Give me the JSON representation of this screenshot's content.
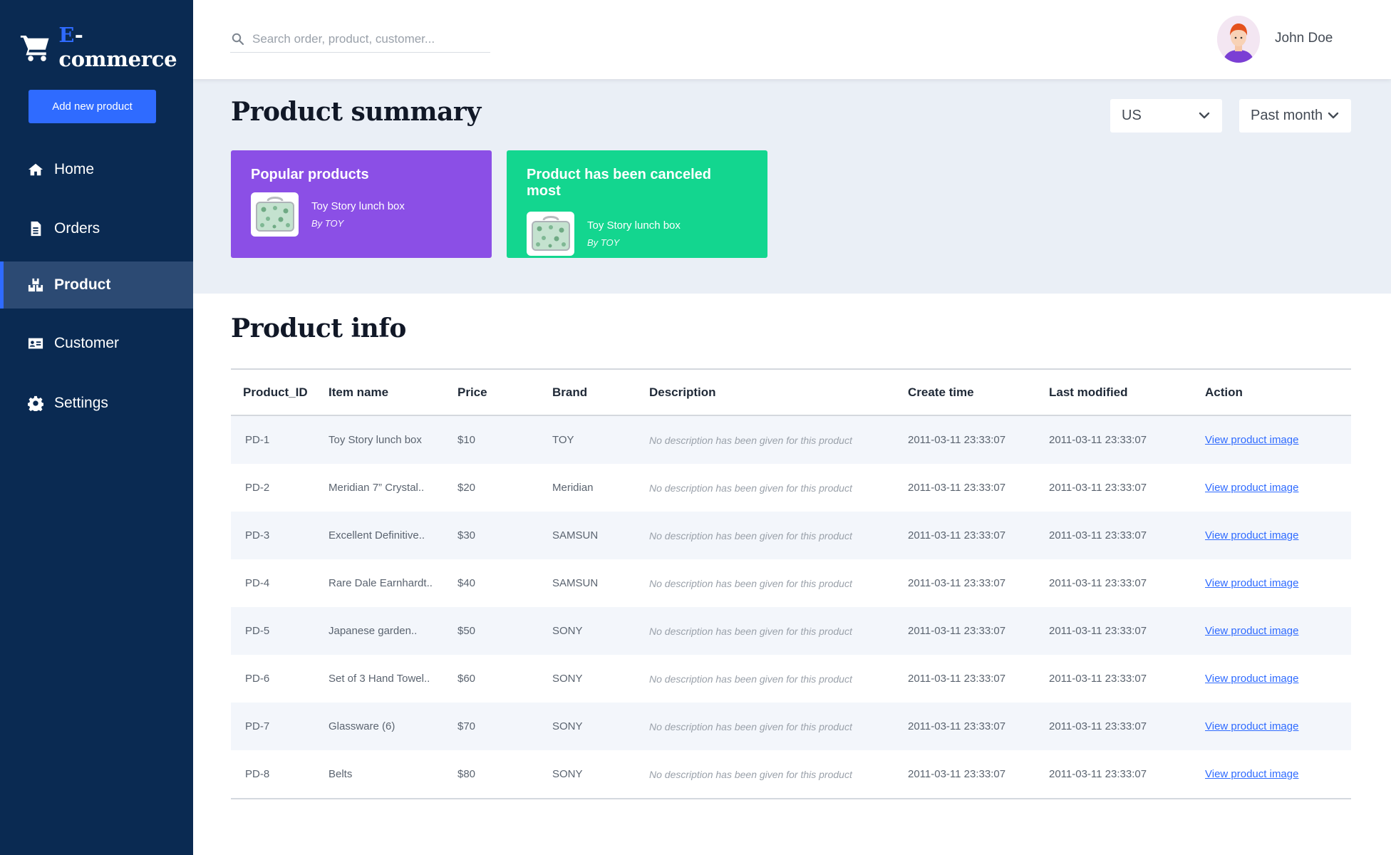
{
  "brand": {
    "first_letter": "E",
    "rest": "-commerce",
    "accent": "#2f6bff"
  },
  "sidebar": {
    "add_button": "Add new product",
    "items": [
      {
        "label": "Home",
        "icon": "home-icon"
      },
      {
        "label": "Orders",
        "icon": "document-icon"
      },
      {
        "label": "Product",
        "icon": "boxes-icon",
        "active": true
      },
      {
        "label": "Customer",
        "icon": "id-card-icon"
      },
      {
        "label": "Settings",
        "icon": "gear-icon"
      }
    ]
  },
  "header": {
    "search_placeholder": "Search order, product, customer...",
    "user_name": "John Doe"
  },
  "summary": {
    "title": "Product summary",
    "region_select": "US",
    "period_select": "Past month",
    "cards": [
      {
        "title": "Popular products",
        "product": "Toy Story lunch box",
        "by": "By TOY",
        "color": "#8b4fe6"
      },
      {
        "title": "Product has been canceled most",
        "product": "Toy Story lunch box",
        "by": "By TOY",
        "color": "#13d68f"
      }
    ]
  },
  "product_info": {
    "title": "Product info",
    "columns": [
      "Product_ID",
      "Item name",
      "Price",
      "Brand",
      "Description",
      "Create time",
      "Last modified",
      "Action"
    ],
    "rows": [
      {
        "id": "PD-1",
        "name": "Toy Story lunch box",
        "price": "$10",
        "brand": "TOY",
        "description": "No description has been given for this product",
        "created": "2011-03-11 23:33:07",
        "modified": "2011-03-11 23:33:07",
        "action": "View product image"
      },
      {
        "id": "PD-2",
        "name": "Meridian 7” Crystal..",
        "price": "$20",
        "brand": "Meridian",
        "description": "No description has been given for this product",
        "created": "2011-03-11 23:33:07",
        "modified": "2011-03-11 23:33:07",
        "action": "View product image"
      },
      {
        "id": "PD-3",
        "name": "Excellent Definitive..",
        "price": "$30",
        "brand": "SAMSUN",
        "description": "No description has been given for this product",
        "created": "2011-03-11 23:33:07",
        "modified": "2011-03-11 23:33:07",
        "action": "View product image"
      },
      {
        "id": "PD-4",
        "name": "Rare Dale Earnhardt..",
        "price": "$40",
        "brand": "SAMSUN",
        "description": "No description has been given for this product",
        "created": "2011-03-11 23:33:07",
        "modified": "2011-03-11 23:33:07",
        "action": "View product image"
      },
      {
        "id": "PD-5",
        "name": "Japanese garden..",
        "price": "$50",
        "brand": "SONY",
        "description": "No description has been given for this product",
        "created": "2011-03-11 23:33:07",
        "modified": "2011-03-11 23:33:07",
        "action": "View product image"
      },
      {
        "id": "PD-6",
        "name": "Set of 3 Hand Towel..",
        "price": "$60",
        "brand": "SONY",
        "description": "No description has been given for this product",
        "created": "2011-03-11 23:33:07",
        "modified": "2011-03-11 23:33:07",
        "action": "View product image"
      },
      {
        "id": "PD-7",
        "name": "Glassware (6)",
        "price": "$70",
        "brand": "SONY",
        "description": "No description has been given for this product",
        "created": "2011-03-11 23:33:07",
        "modified": "2011-03-11 23:33:07",
        "action": "View product image"
      },
      {
        "id": "PD-8",
        "name": "Belts",
        "price": "$80",
        "brand": "SONY",
        "description": "No description has been given for this product",
        "created": "2011-03-11 23:33:07",
        "modified": "2011-03-11 23:33:07",
        "action": "View product image"
      }
    ]
  }
}
